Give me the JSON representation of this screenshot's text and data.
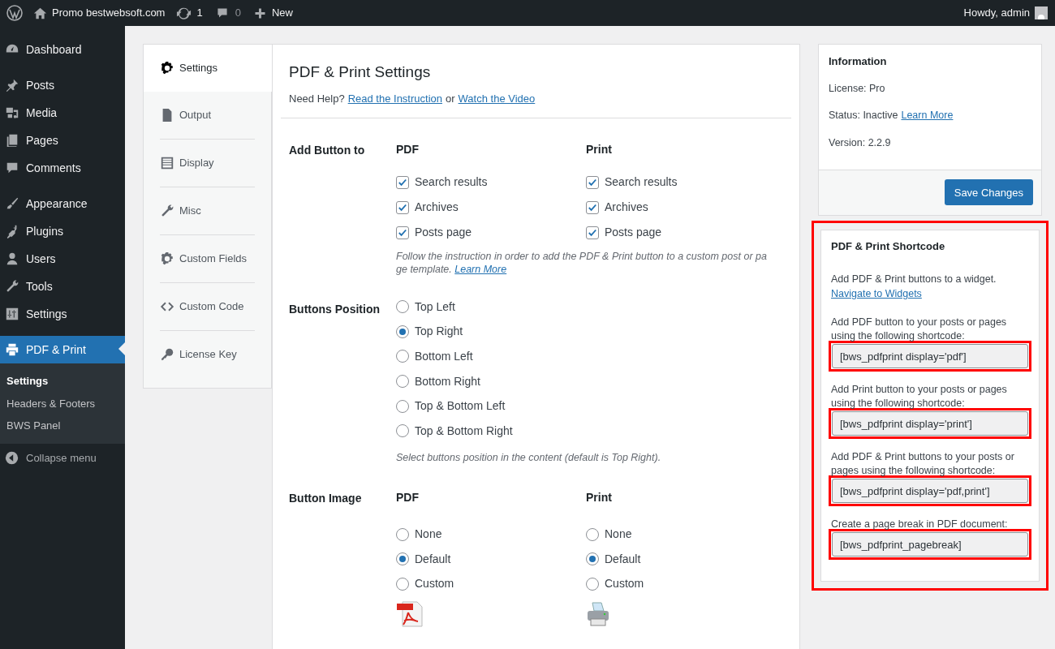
{
  "admin_bar": {
    "site": "Promo bestwebsoft.com",
    "updates": "1",
    "comments": "0",
    "new": "New",
    "greeting": "Howdy, admin"
  },
  "sidebar": {
    "groups": [
      {
        "items": [
          {
            "label": "Dashboard",
            "kind": "gauge",
            "selected": false
          }
        ]
      },
      {
        "items": [
          {
            "label": "Posts",
            "kind": "pin",
            "selected": false
          },
          {
            "label": "Media",
            "kind": "media",
            "selected": false
          },
          {
            "label": "Pages",
            "kind": "pages",
            "selected": false
          },
          {
            "label": "Comments",
            "kind": "bubble",
            "selected": false
          }
        ]
      },
      {
        "items": [
          {
            "label": "Appearance",
            "kind": "brush",
            "selected": false
          },
          {
            "label": "Plugins",
            "kind": "plug",
            "selected": false
          },
          {
            "label": "Users",
            "kind": "user",
            "selected": false
          },
          {
            "label": "Tools",
            "kind": "wrench",
            "selected": false
          },
          {
            "label": "Settings",
            "kind": "sliders",
            "selected": false
          }
        ]
      },
      {
        "items": [
          {
            "label": "PDF & Print",
            "kind": "printer",
            "selected": true
          }
        ]
      }
    ],
    "submenu": [
      {
        "label": "Settings",
        "selected": true
      },
      {
        "label": "Headers & Footers",
        "selected": false
      },
      {
        "label": "BWS Panel",
        "selected": false
      }
    ],
    "collapse": "Collapse menu"
  },
  "tabs": [
    {
      "label": "Settings",
      "kind": "gear",
      "selected": true
    },
    {
      "label": "Output",
      "kind": "file",
      "selected": false
    },
    {
      "label": "Display",
      "kind": "list",
      "selected": false
    },
    {
      "label": "Misc",
      "kind": "wrench",
      "selected": false
    },
    {
      "label": "Custom Fields",
      "kind": "gear",
      "selected": false
    },
    {
      "label": "Custom Code",
      "kind": "code",
      "selected": false
    },
    {
      "label": "License Key",
      "kind": "key",
      "selected": false
    }
  ],
  "page": {
    "title": "PDF & Print Settings",
    "help_prefix": "Need Help?",
    "help_links": [
      "Read the Instruction",
      "Watch the Video"
    ],
    "help_joiner": "or",
    "add_button": {
      "label": "Add Button to",
      "columns": [
        {
          "heading": "PDF",
          "options": [
            {
              "label": "Search results",
              "checked": true
            },
            {
              "label": "Archives",
              "checked": true
            },
            {
              "label": "Posts page",
              "checked": true
            }
          ]
        },
        {
          "heading": "Print",
          "options": [
            {
              "label": "Search results",
              "checked": true
            },
            {
              "label": "Archives",
              "checked": true
            },
            {
              "label": "Posts page",
              "checked": true
            }
          ]
        }
      ],
      "note": "Follow the instruction in order to add the PDF & Print button to a custom post or pa ge template.",
      "note_link": "Learn More"
    },
    "buttons_position": {
      "label": "Buttons Position",
      "options": [
        {
          "label": "Top Left",
          "selected": false
        },
        {
          "label": "Top Right",
          "selected": true
        },
        {
          "label": "Bottom Left",
          "selected": false
        },
        {
          "label": "Bottom Right",
          "selected": false
        },
        {
          "label": "Top & Bottom Left",
          "selected": false
        },
        {
          "label": "Top & Bottom Right",
          "selected": false
        }
      ],
      "note": "Select buttons position in the content (default is Top Right)."
    },
    "button_image": {
      "label": "Button Image",
      "columns": [
        {
          "heading": "PDF",
          "kind": "pdf",
          "options": [
            {
              "label": "None",
              "selected": false
            },
            {
              "label": "Default",
              "selected": true
            },
            {
              "label": "Custom",
              "selected": false
            }
          ]
        },
        {
          "heading": "Print",
          "kind": "printer",
          "options": [
            {
              "label": "None",
              "selected": false
            },
            {
              "label": "Default",
              "selected": true
            },
            {
              "label": "Custom",
              "selected": false
            }
          ]
        }
      ]
    }
  },
  "info": {
    "title": "Information",
    "rows": [
      {
        "label": "License:",
        "value": "Pro"
      },
      {
        "label": "Status:",
        "value": "Inactive",
        "link": "Learn More"
      },
      {
        "label": "Version:",
        "value": "2.2.9"
      }
    ],
    "button": "Save Changes"
  },
  "shortcode": {
    "title": "PDF & Print Shortcode",
    "highlighted": true,
    "widget_text": "Add PDF & Print buttons to a widget.",
    "widget_link": "Navigate to Widgets",
    "items": [
      {
        "text": "Add PDF button to your posts or pages using the following shortcode:",
        "code": "[bws_pdfprint display='pdf']",
        "highlighted": true
      },
      {
        "text": "Add Print button to your posts or pages using the following shortcode:",
        "code": "[bws_pdfprint display='print']",
        "highlighted": true
      },
      {
        "text": "Add PDF & Print buttons to your posts or pages using the following shortcode:",
        "code": "[bws_pdfprint display='pdf,print']",
        "highlighted": true
      },
      {
        "text": "Create a page break in PDF document:",
        "code": "[bws_pdfprint_pagebreak]",
        "highlighted": true
      }
    ]
  }
}
